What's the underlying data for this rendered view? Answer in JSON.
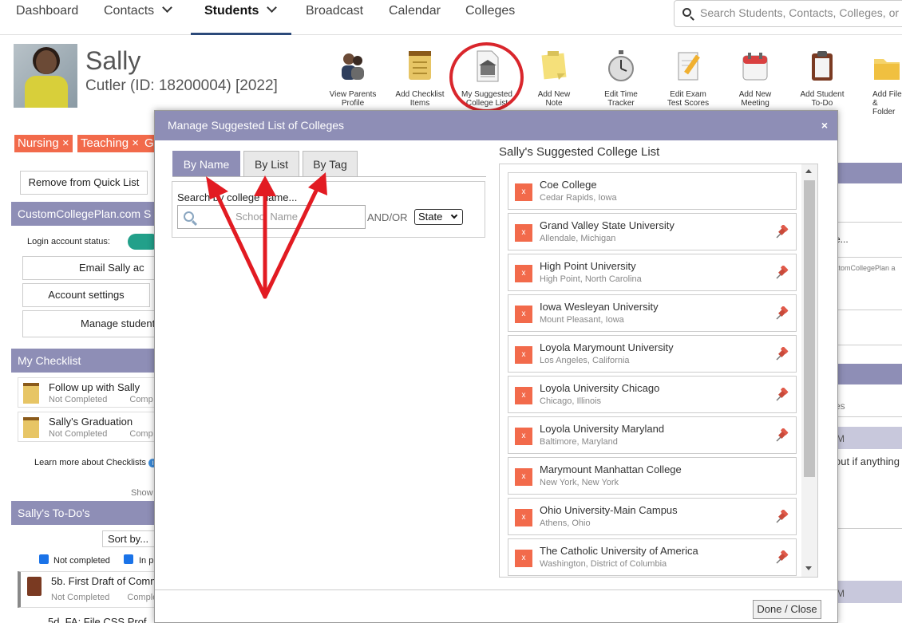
{
  "nav": {
    "dashboard": "Dashboard",
    "contacts": "Contacts",
    "students": "Students",
    "broadcast": "Broadcast",
    "calendar": "Calendar",
    "colleges": "Colleges",
    "search_placeholder": "Search Students, Contacts, Colleges, or Notes"
  },
  "profile": {
    "first_name": "Sally",
    "sub": "Cutler (ID: 18200004) [2022]"
  },
  "toolbar": [
    {
      "l1": "View Parents",
      "l2": "Profile",
      "icon": "parents-icon"
    },
    {
      "l1": "Add Checklist",
      "l2": "Items",
      "icon": "checklist-icon"
    },
    {
      "l1": "My Suggested",
      "l2": "College List",
      "icon": "college-list-icon"
    },
    {
      "l1": "Add New",
      "l2": "Note",
      "icon": "note-icon"
    },
    {
      "l1": "Edit Time",
      "l2": "Tracker",
      "icon": "stopwatch-icon"
    },
    {
      "l1": "Edit Exam",
      "l2": "Test Scores",
      "icon": "exam-icon"
    },
    {
      "l1": "Add New",
      "l2": "Meeting",
      "icon": "calendar-icon"
    },
    {
      "l1": "Add Student",
      "l2": "To-Do",
      "icon": "clipboard-icon"
    },
    {
      "l1": "Add File",
      "l2": "& Folder",
      "icon": "folder-icon"
    }
  ],
  "left": {
    "tags": [
      "Nursing",
      "Teaching",
      "G"
    ],
    "remove_quick": "Remove from Quick List",
    "ccp_header": "CustomCollegePlan.com S",
    "login_status": "Login account status:",
    "email_btn": "Email Sally ac",
    "account_settings": "Account settings",
    "manage_student": "Manage student",
    "checklist_header": "My Checklist",
    "checklist_items": [
      {
        "title": "Follow up with Sally",
        "status": "Not Completed",
        "extra": "Comp"
      },
      {
        "title": "Sally's Graduation",
        "status": "Not Completed",
        "extra": "Comp"
      }
    ],
    "learn_more": "Learn more about Checklists",
    "show": "Show",
    "todos_header": "Sally's To-Do's",
    "sort_by": "Sort by...",
    "not_completed_filter": "Not completed",
    "in_progress_filter": "In p",
    "todo_item": {
      "title": "5b. First Draft of Comm",
      "status": "Not Completed",
      "extra": "Comple"
    },
    "todo_item2": "5d. FA: File CSS Prof"
  },
  "right": {
    "t1": "e...",
    "t2": "stomCollegePlan a",
    "t3": "es",
    "t4": "M",
    "t5": "out if anything",
    "t6": "M"
  },
  "modal": {
    "title": "Manage Suggested List of Colleges",
    "close": "×",
    "tabs": [
      "By Name",
      "By List",
      "By Tag"
    ],
    "search_label": "Search by college name...",
    "search_placeholder": "School Name",
    "andor": "AND/OR",
    "state_select": "State",
    "list_title": "Sally's Suggested College List",
    "remove_glyph": "x",
    "colleges": [
      {
        "name": "Coe College",
        "loc": "Cedar Rapids, Iowa",
        "pin": false
      },
      {
        "name": "Grand Valley State University",
        "loc": "Allendale, Michigan",
        "pin": true
      },
      {
        "name": "High Point University",
        "loc": "High Point, North Carolina",
        "pin": true
      },
      {
        "name": "Iowa Wesleyan University",
        "loc": "Mount Pleasant, Iowa",
        "pin": true
      },
      {
        "name": "Loyola Marymount University",
        "loc": "Los Angeles, California",
        "pin": true
      },
      {
        "name": "Loyola University Chicago",
        "loc": "Chicago, Illinois",
        "pin": true
      },
      {
        "name": "Loyola University Maryland",
        "loc": "Baltimore, Maryland",
        "pin": true
      },
      {
        "name": "Marymount Manhattan College",
        "loc": "New York, New York",
        "pin": false
      },
      {
        "name": "Ohio University-Main Campus",
        "loc": "Athens, Ohio",
        "pin": true
      },
      {
        "name": "The Catholic University of America",
        "loc": "Washington, District of Columbia",
        "pin": true
      }
    ],
    "done": "Done / Close"
  },
  "colors": {
    "accent": "#8e8eb6",
    "tag": "#f26a4b",
    "annotation": "#d9262c"
  }
}
